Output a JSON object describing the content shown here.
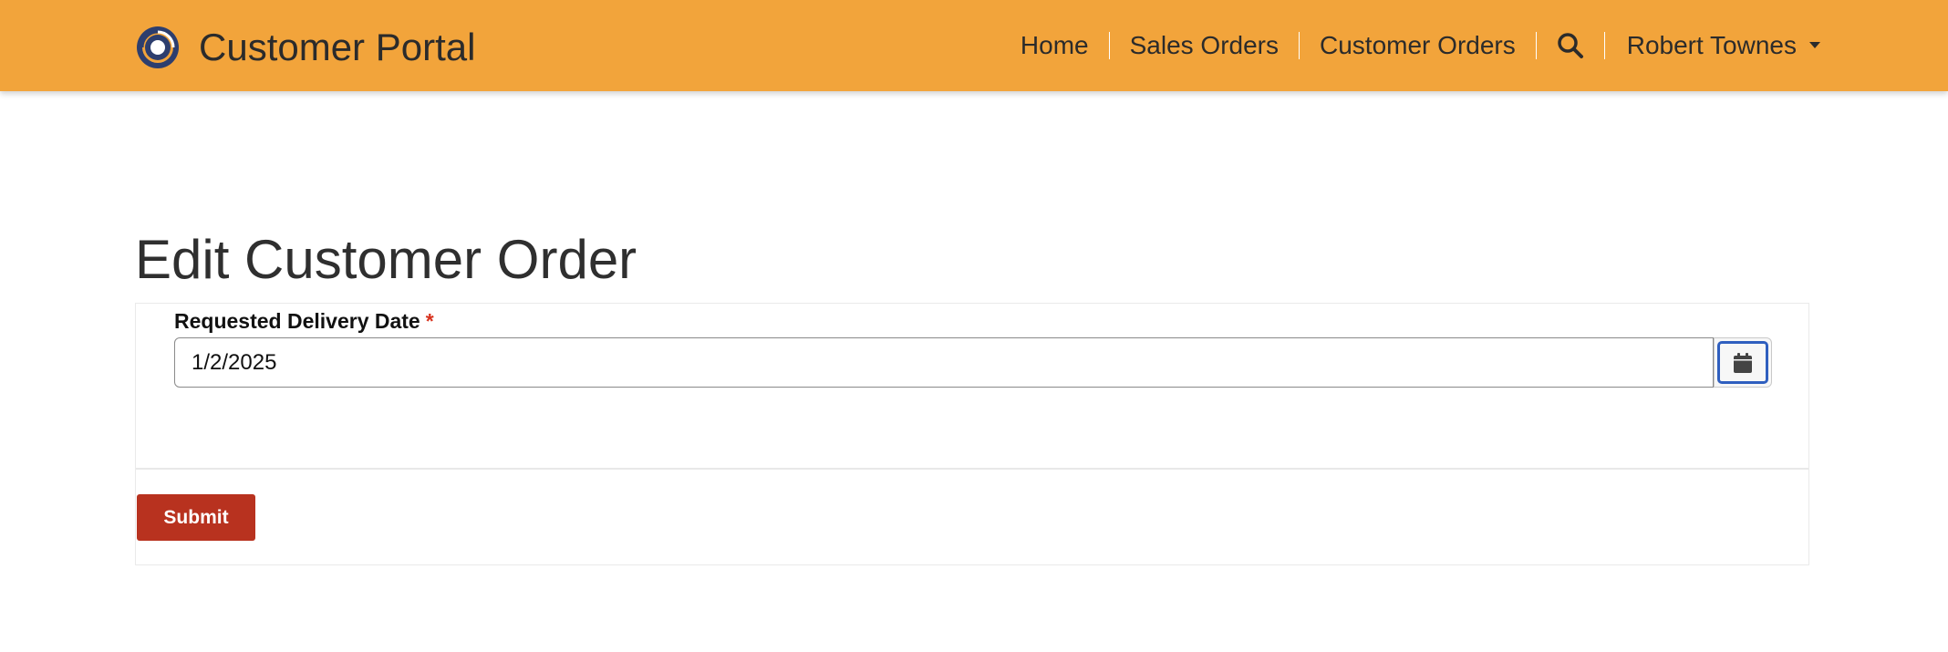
{
  "app": {
    "title": "Customer Portal"
  },
  "nav": {
    "home": "Home",
    "sales_orders": "Sales Orders",
    "customer_orders": "Customer Orders",
    "user_name": "Robert Townes"
  },
  "page": {
    "title": "Edit Customer Order"
  },
  "form": {
    "delivery_date_label": "Requested Delivery Date",
    "required_mark": "*",
    "delivery_date_value": "1/2/2025",
    "submit_label": "Submit"
  },
  "icons": {
    "logo": "portal-logo-icon",
    "search": "search-icon",
    "calendar": "calendar-icon",
    "caret": "caret-down-icon"
  },
  "colors": {
    "header_bg": "#f2a43b",
    "submit_bg": "#b8321f",
    "required": "#d8321e",
    "focus_ring": "#2f5fbf",
    "logo": "#2d3e6e"
  }
}
